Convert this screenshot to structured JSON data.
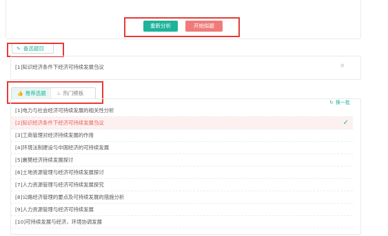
{
  "toolbar": {
    "reanalyze_label": "重新分析",
    "start_label": "开始拟题"
  },
  "alternatives": {
    "title": "备选题目",
    "items": [
      "[1]知识经济条件下经济可持续发展刍议"
    ],
    "close_symbol": "×"
  },
  "tabs": {
    "recommended": "推荐选题",
    "hot_templates": "热门模板",
    "active": "recommended"
  },
  "refresh_label": "换一批",
  "topics": [
    "[1]电力与社会经济可持续发展的相关性分析",
    "[2]知识经济条件下经济可持续发展刍议",
    "[3]工商管理对经济持续发展的作用",
    "[4]环境法制建设与中国经济的可持续发展",
    "[5]襄樊经济持续发展探讨",
    "[6]土地资源管理与经济可持续发展探讨",
    "[7]人力资源管理与经济可持续发展探究",
    "[8]公路经济管理的要点及可持续发展的措施分析",
    "[9]人力资源管理与经济可持续发展",
    "[10]可持续发展与经济，环境协调发展"
  ],
  "selected_topic_index": 1,
  "colors": {
    "accent": "#1fb39b",
    "danger": "#f07a7a",
    "highlight_box": "#e53935"
  },
  "icons": {
    "alt_title": "pencil-icon",
    "recommended_tab": "thumbs-up-icon",
    "hot_tab": "flame-icon",
    "refresh": "refresh-icon",
    "selected": "checkmark-icon"
  }
}
